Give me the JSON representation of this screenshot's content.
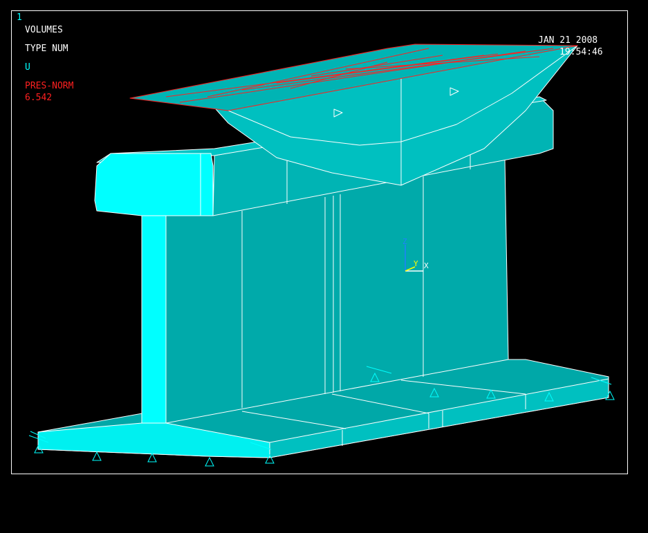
{
  "window": {
    "number": "1"
  },
  "legend": {
    "line1": "VOLUMES",
    "line2": "TYPE NUM",
    "line3": "U",
    "line4": "PRES-NORM",
    "line5": "6.542"
  },
  "timestamp": {
    "date": "JAN 21 2008",
    "time": "19:54:46"
  },
  "triad": {
    "z": "Z",
    "y": "Y",
    "x": "X"
  },
  "colors": {
    "background": "#000000",
    "volume_light": "#00ffff",
    "volume_mid": "#00c8c8",
    "volume_dark": "#009a9a",
    "edges": "#ffffff",
    "pressure": "#ff2020",
    "constraints": "#00ffff"
  }
}
